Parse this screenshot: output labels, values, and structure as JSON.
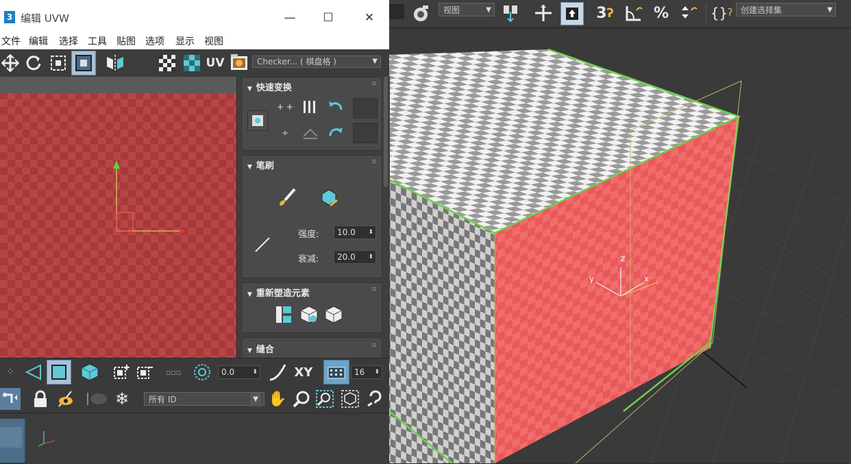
{
  "window": {
    "title": "编辑 UVW",
    "app_icon": "3",
    "minimize": "—",
    "maximize": "☐",
    "close": "✕"
  },
  "menu": [
    "文件",
    "编辑",
    "选择",
    "工具",
    "贴图",
    "选项",
    "显示",
    "视图"
  ],
  "uv_toolbar": {
    "uv_label": "UV",
    "texture_dropdown": "Checker... ( 棋盘格 )"
  },
  "main_toolbar": {
    "view_dropdown": "视图",
    "selection_set_dropdown": "创建选择集"
  },
  "panels": {
    "quick_transform": {
      "title": "快速变换"
    },
    "brush": {
      "title": "笔刷",
      "strength_label": "强度:",
      "strength_value": "10.0",
      "falloff_label": "衰减:",
      "falloff_value": "20.0"
    },
    "reshape": {
      "title": "重新塑造元素"
    },
    "stitch": {
      "title": "缝合"
    }
  },
  "bottom_toolbar": {
    "soft_select_value": "0.0",
    "xy_label": "XY",
    "grid_value": "16",
    "filter_dropdown": "所有 ID"
  },
  "viewport": {
    "gizmo_axes": [
      "z",
      "y",
      "x"
    ]
  },
  "colors": {
    "uv_canvas": "#b24040",
    "cube_front": "#f06868",
    "selection_green": "#6fd04a",
    "accent_teal": "#5ec8d8"
  }
}
